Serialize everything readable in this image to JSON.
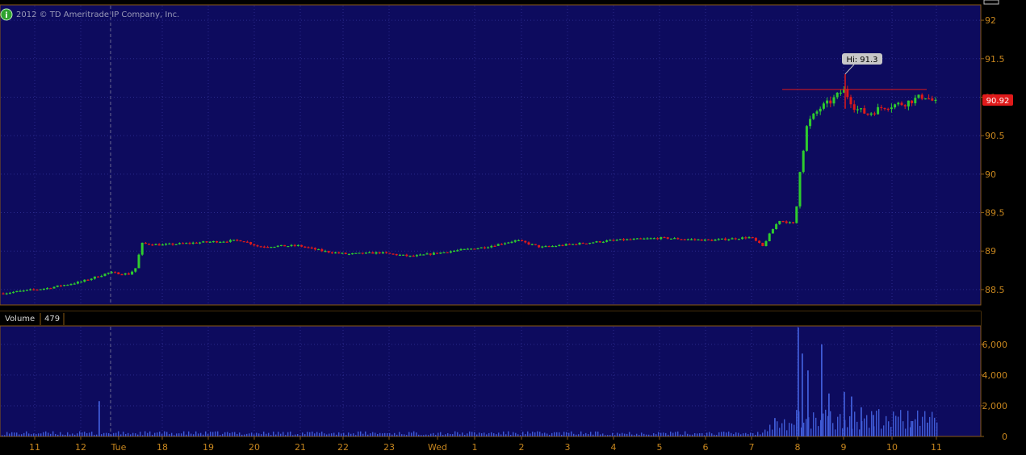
{
  "copyright": "2012 © TD Ameritrade IP Company, Inc.",
  "info_icon": "info-icon",
  "colors": {
    "background": "#000000",
    "plot_bg": "#0d0b5e",
    "grid": "#2a2a8c",
    "frame": "#8a5a12",
    "axis_text": "#c7861e",
    "up": "#2ecc2e",
    "down": "#e01a1a",
    "volume": "#3f5bd6",
    "hi_line": "#e01a1a",
    "price_badge": "#e01a1a"
  },
  "price_axis": {
    "ticks": [
      "92",
      "91.5",
      "91",
      "90.5",
      "90",
      "89.5",
      "89",
      "88.5"
    ],
    "current_price": "90.92",
    "range": [
      88.3,
      92.2
    ]
  },
  "hi_label": "Hi: 91.3",
  "volume_panel": {
    "title": "Volume",
    "value": "479",
    "ticks": [
      "6,000",
      "4,000",
      "2,000",
      "0"
    ],
    "range": [
      0,
      7200
    ]
  },
  "x_axis": {
    "labels": [
      "11",
      "12",
      "Tue",
      "18",
      "19",
      "20",
      "21",
      "22",
      "23",
      "Wed",
      "1",
      "2",
      "3",
      "4",
      "5",
      "6",
      "7",
      "8",
      "9",
      "10",
      "11"
    ]
  },
  "chart_data": {
    "type": "candlestick",
    "title": "",
    "price": {
      "series": [
        {
          "x": "11",
          "y": 88.48
        },
        {
          "x": "12",
          "y": 88.62
        },
        {
          "x": "Tue",
          "y": 89.05
        },
        {
          "x": "18",
          "y": 89.1
        },
        {
          "x": "19",
          "y": 89.12
        },
        {
          "x": "20",
          "y": 89.07
        },
        {
          "x": "21",
          "y": 89.05
        },
        {
          "x": "22",
          "y": 88.97
        },
        {
          "x": "23",
          "y": 88.93
        },
        {
          "x": "Wed",
          "y": 88.99
        },
        {
          "x": "1",
          "y": 89.05
        },
        {
          "x": "2",
          "y": 89.1
        },
        {
          "x": "3",
          "y": 89.1
        },
        {
          "x": "4",
          "y": 89.15
        },
        {
          "x": "5",
          "y": 89.18
        },
        {
          "x": "6",
          "y": 89.15
        },
        {
          "x": "7",
          "y": 89.2
        },
        {
          "x": "8",
          "y": 90.5
        },
        {
          "x": "9",
          "y": 90.9
        },
        {
          "x": "10",
          "y": 90.88
        },
        {
          "x": "11",
          "y": 90.92
        }
      ],
      "high": 91.3,
      "last": 90.92,
      "ylim": [
        88.3,
        92.2
      ]
    },
    "volume": {
      "ylim": [
        0,
        7200
      ],
      "notable_bars": [
        {
          "x": "Tue",
          "y": 2300
        },
        {
          "x": "8",
          "y": 7100
        },
        {
          "x": "8",
          "y": 6000
        },
        {
          "x": "9",
          "y": 2900
        },
        {
          "x": "9",
          "y": 2600
        }
      ]
    },
    "grid": true
  }
}
